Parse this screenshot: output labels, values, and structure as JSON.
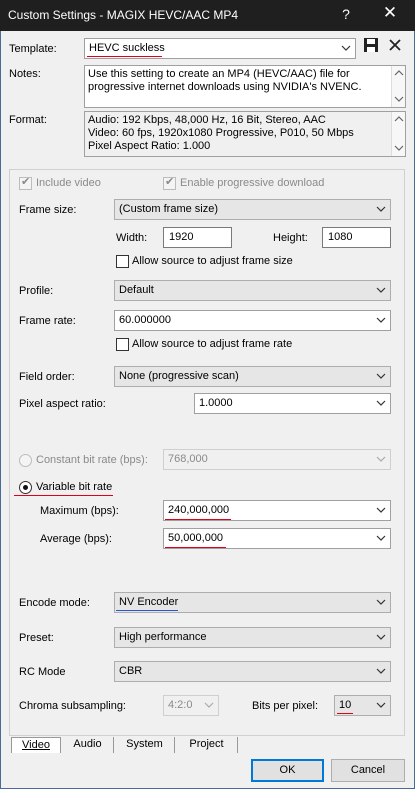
{
  "window": {
    "title": "Custom Settings - MAGIX HEVC/AAC MP4",
    "help": "?",
    "close": "✕"
  },
  "template": {
    "label": "Template:",
    "value": "HEVC suckless"
  },
  "notes": {
    "label": "Notes:",
    "value": "Use this setting to create an MP4 (HEVC/AAC) file for progressive internet downloads using NVIDIA's NVENC."
  },
  "format": {
    "label": "Format:",
    "lines": [
      "Audio: 192 Kbps, 48,000 Hz, 16 Bit, Stereo, AAC",
      "Video: 60 fps, 1920x1080 Progressive, P010, 50 Mbps",
      "Pixel Aspect Ratio: 1.000"
    ]
  },
  "video": {
    "include_video": "Include video",
    "progressive_download": "Enable progressive download",
    "frame_size_label": "Frame size:",
    "frame_size": "(Custom frame size)",
    "width_label": "Width:",
    "width": "1920",
    "height_label": "Height:",
    "height": "1080",
    "allow_frame_size": "Allow source to adjust frame size",
    "profile_label": "Profile:",
    "profile": "Default",
    "frame_rate_label": "Frame rate:",
    "frame_rate": "60.000000",
    "allow_frame_rate": "Allow source to adjust frame rate",
    "field_order_label": "Field order:",
    "field_order": "None (progressive scan)",
    "par_label": "Pixel aspect ratio:",
    "par": "1.0000",
    "cbr_label": "Constant bit rate (bps):",
    "cbr": "768,000",
    "vbr_label": "Variable bit rate",
    "max_label": "Maximum (bps):",
    "max": "240,000,000",
    "avg_label": "Average (bps):",
    "avg": "50,000,000",
    "encode_mode_label": "Encode mode:",
    "encode_mode": "NV Encoder",
    "preset_label": "Preset:",
    "preset": "High performance",
    "rc_label": "RC Mode",
    "rc": "CBR",
    "chroma_label": "Chroma subsampling:",
    "chroma": "4:2:0",
    "bpp_label": "Bits per pixel:",
    "bpp": "10"
  },
  "tabs": [
    "Video",
    "Audio",
    "System",
    "Project"
  ],
  "buttons": {
    "ok": "OK",
    "cancel": "Cancel"
  },
  "colors": {
    "annotation_red": "#e0001a",
    "annotation_blue": "#2b54d9",
    "accent": "#0078d7"
  }
}
